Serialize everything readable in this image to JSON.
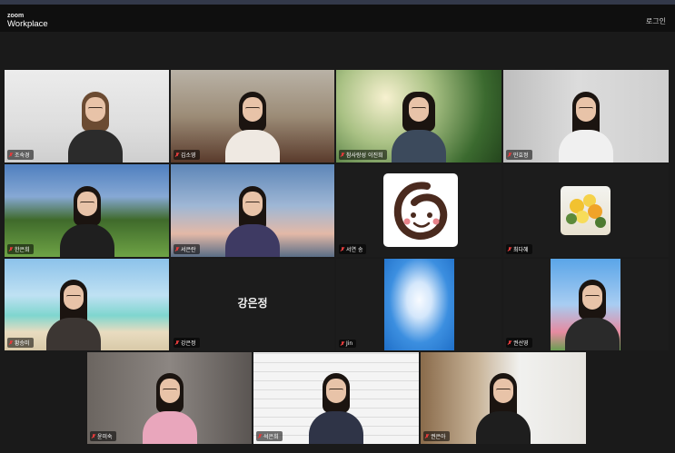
{
  "app": {
    "brand_top": "zoom",
    "brand_bottom": "Workplace",
    "login_label": "로그인"
  },
  "participants": [
    {
      "name": "조숙경"
    },
    {
      "name": "김소영"
    },
    {
      "name": "참사랑성 이진희"
    },
    {
      "name": "민효정"
    },
    {
      "name": "한은희"
    },
    {
      "name": "서은란"
    },
    {
      "name": "서연 송"
    },
    {
      "name": "최다혜"
    },
    {
      "name": "황승미"
    },
    {
      "name": "강은정",
      "display_name": "강은정"
    },
    {
      "name": "Jin"
    },
    {
      "name": "권선영"
    },
    {
      "name": "윤미숙"
    },
    {
      "name": "석은희"
    },
    {
      "name": "권은아"
    }
  ],
  "colors": {
    "active_border": "#23d959",
    "mic_muted": "#e23b3b",
    "background": "#1a1a1a"
  }
}
